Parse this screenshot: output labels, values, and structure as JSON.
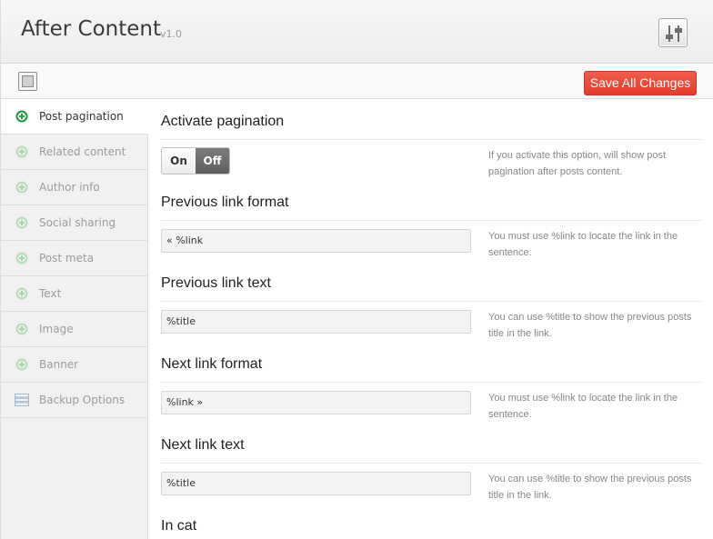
{
  "header": {
    "title": "After Content",
    "version": "v1.0",
    "settings_icon": "sliders-icon"
  },
  "toolbar": {
    "expand_icon": "expand-icon",
    "save_label": "Save All Changes",
    "save_color": "#e8473a"
  },
  "sidebar": {
    "items": [
      {
        "label": "Post pagination",
        "icon": "plus-circle-icon",
        "active": true
      },
      {
        "label": "Related content",
        "icon": "plus-circle-icon",
        "active": false
      },
      {
        "label": "Author info",
        "icon": "plus-circle-icon",
        "active": false
      },
      {
        "label": "Social sharing",
        "icon": "plus-circle-icon",
        "active": false
      },
      {
        "label": "Post meta",
        "icon": "plus-circle-icon",
        "active": false
      },
      {
        "label": "Text",
        "icon": "plus-circle-icon",
        "active": false
      },
      {
        "label": "Image",
        "icon": "plus-circle-icon",
        "active": false
      },
      {
        "label": "Banner",
        "icon": "plus-circle-icon",
        "active": false
      },
      {
        "label": "Backup Options",
        "icon": "list-icon",
        "active": false
      }
    ]
  },
  "main": {
    "activate": {
      "title": "Activate pagination",
      "on_label": "On",
      "off_label": "Off",
      "selected": "Off",
      "description": "If you activate this option, will show post pagination after posts content."
    },
    "prev_format": {
      "title": "Previous link format",
      "value": "« %link",
      "description": "You must use %link to locate the link in the sentence."
    },
    "prev_text": {
      "title": "Previous link text",
      "value": "%title",
      "description": "You can use %title to show the previous posts title in the link."
    },
    "next_format": {
      "title": "Next link format",
      "value": "%link »",
      "description": "You must use %link to locate the link in the sentence."
    },
    "next_text": {
      "title": "Next link text",
      "value": "%title",
      "description": "You can use %title to show the previous posts title in the link."
    },
    "in_cat": {
      "title": "In cat"
    }
  }
}
